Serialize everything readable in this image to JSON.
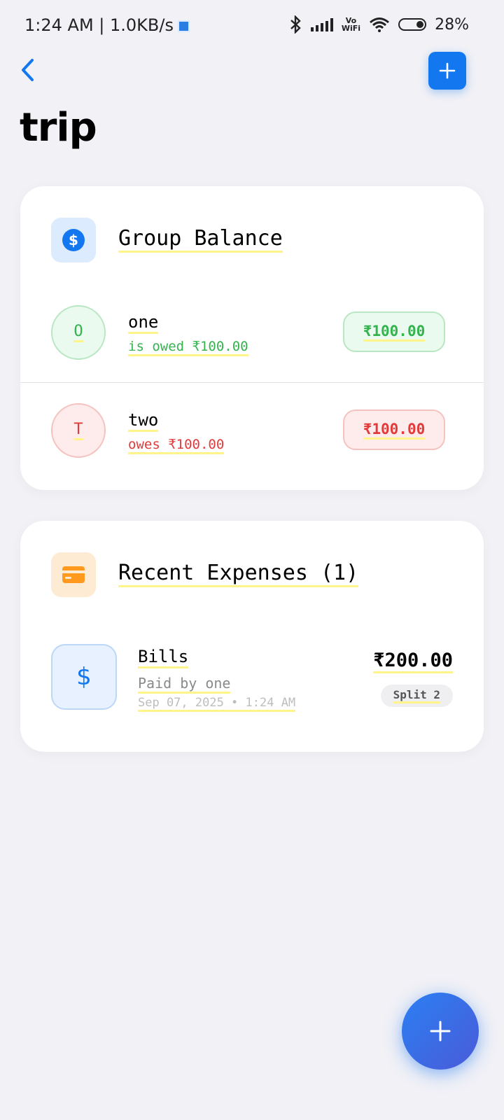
{
  "status_bar": {
    "time_speed": "1:24 AM | 1.0KB/s",
    "vowifi_top": "Vo",
    "vowifi_bottom": "WiFi",
    "battery": "28%"
  },
  "header": {
    "title": "trip"
  },
  "group_balance": {
    "title": "Group Balance",
    "icon": "dollar-coin-icon",
    "members": [
      {
        "initial": "O",
        "name": "one",
        "status": "is owed ₹100.00",
        "amount": "₹100.00",
        "tone": "positive"
      },
      {
        "initial": "T",
        "name": "two",
        "status": "owes ₹100.00",
        "amount": "₹100.00",
        "tone": "negative"
      }
    ]
  },
  "recent_expenses": {
    "title": "Recent Expenses (1)",
    "icon": "credit-card-icon",
    "items": [
      {
        "icon": "$",
        "name": "Bills",
        "paid_by": "Paid by one",
        "date": "Sep 07, 2025 • 1:24 AM",
        "amount": "₹200.00",
        "split": "Split 2"
      }
    ]
  },
  "colors": {
    "accent": "#1378f0",
    "positive": "#34b34f",
    "negative": "#e23b3b",
    "background": "#f1f1f6",
    "orange": "#ff9a1f"
  }
}
